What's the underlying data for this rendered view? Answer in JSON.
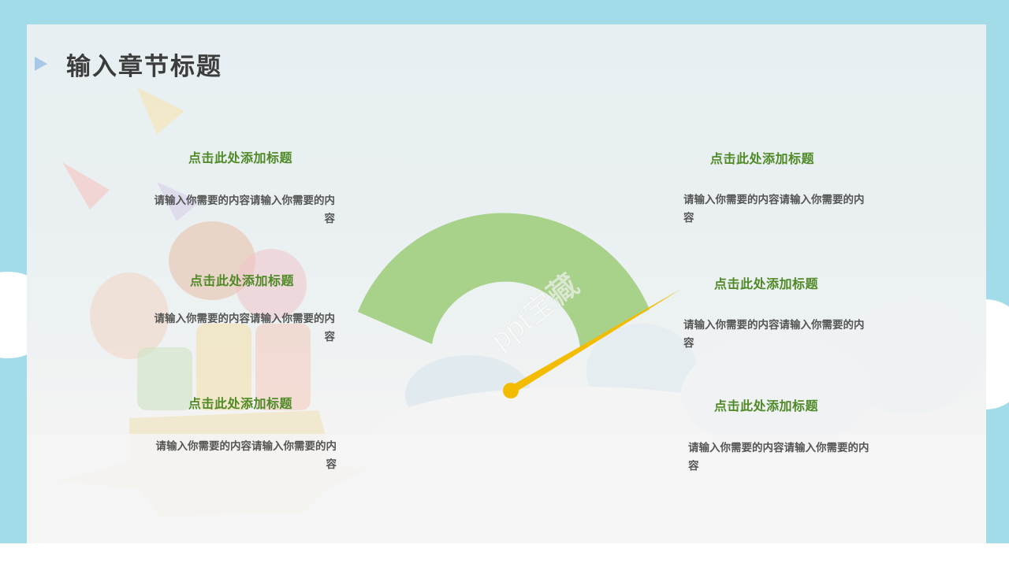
{
  "header": {
    "title": "输入章节标题"
  },
  "watermark": "ppt宝藏",
  "left_items": [
    {
      "title": "点击此处添加标题",
      "body": "请输入你需要的内容请输入你需要的内容"
    },
    {
      "title": "点击此处添加标题",
      "body": "请输入你需要的内容请输入你需要的内容"
    },
    {
      "title": "点击此处添加标题",
      "body": "请输入你需要的内容请输入你需要的内容"
    }
  ],
  "right_items": [
    {
      "title": "点击此处添加标题",
      "body": "请输入你需要的内容请输入你需要的内容"
    },
    {
      "title": "点击此处添加标题",
      "body": "请输入你需要的内容请输入你需要的内容"
    },
    {
      "title": "点击此处添加标题",
      "body": "请输入你需要的内容请输入你需要的内容"
    }
  ],
  "colors": {
    "sky": "#a2dce9",
    "gauge_fill": "#a8d18a",
    "needle": "#f4bc00",
    "title_green": "#4f8a26"
  }
}
